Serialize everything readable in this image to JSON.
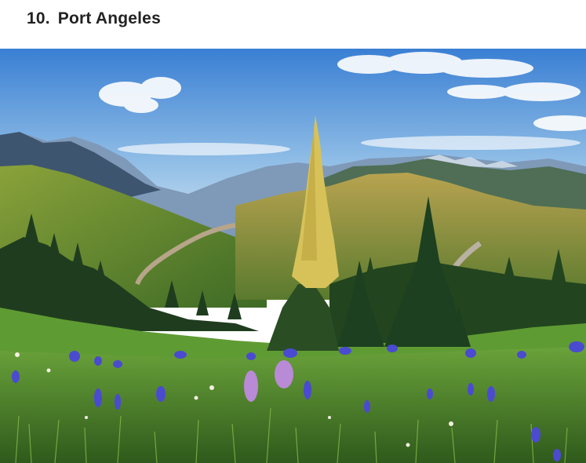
{
  "article": {
    "number": "10.",
    "title": "Port Angeles"
  },
  "photo": {
    "subject": "mountain-meadow-landscape",
    "colors": {
      "sky_top": "#3f86d6",
      "sky_bottom": "#cfe3f4",
      "mountain_far": "#7d95b3",
      "mountain_mid": "#4b6a54",
      "forest_dark": "#1f3b1f",
      "meadow": "#4f8a2a",
      "lupine": "#4a4bd0",
      "sunlit_tree": "#d7c25a"
    }
  }
}
